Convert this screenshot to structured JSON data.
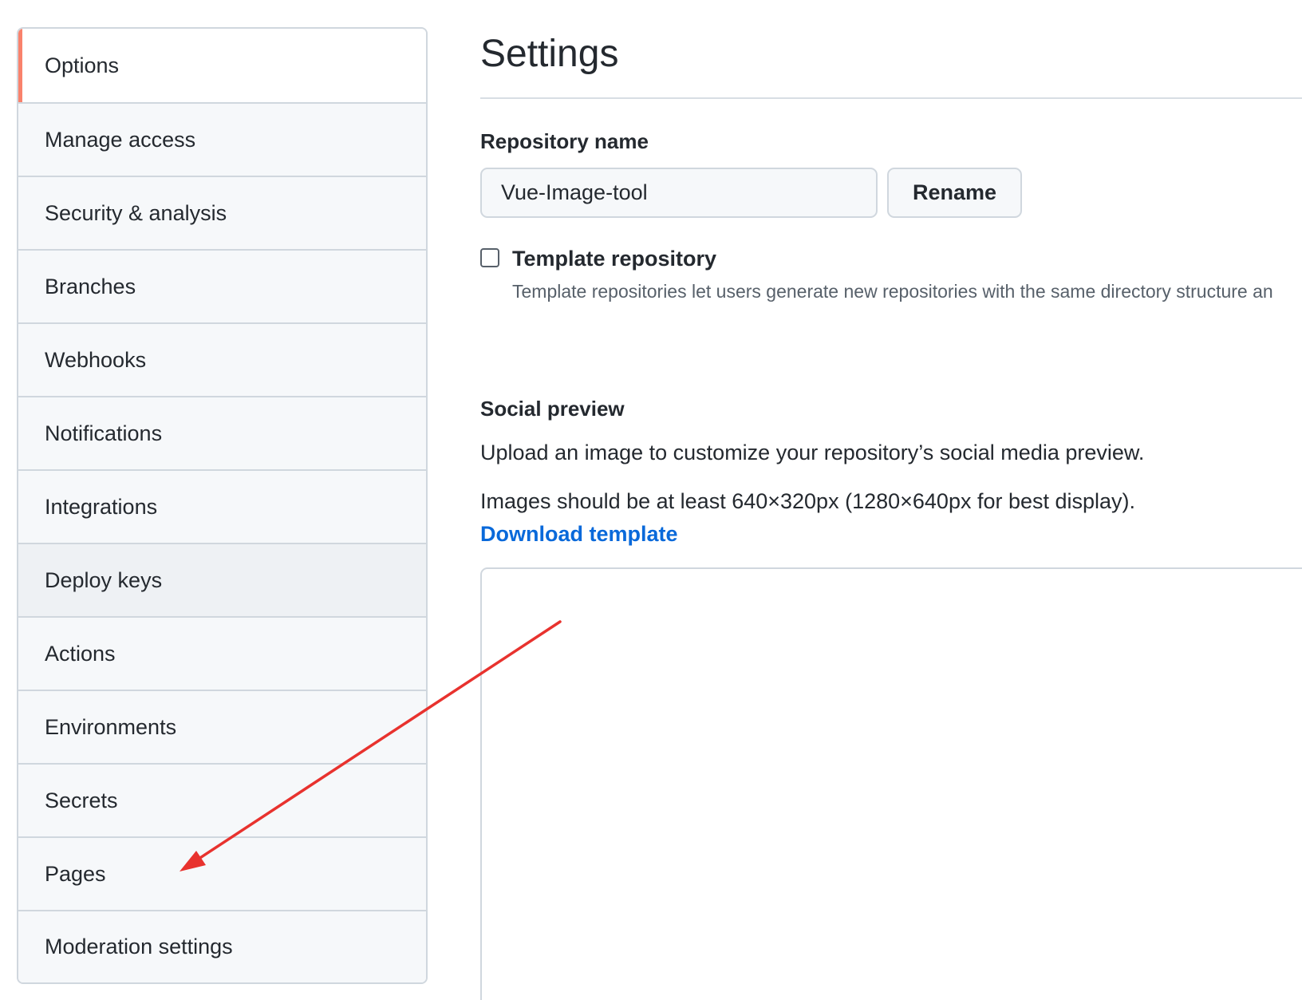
{
  "sidebar": {
    "items": [
      {
        "label": "Options"
      },
      {
        "label": "Manage access"
      },
      {
        "label": "Security & analysis"
      },
      {
        "label": "Branches"
      },
      {
        "label": "Webhooks"
      },
      {
        "label": "Notifications"
      },
      {
        "label": "Integrations"
      },
      {
        "label": "Deploy keys"
      },
      {
        "label": "Actions"
      },
      {
        "label": "Environments"
      },
      {
        "label": "Secrets"
      },
      {
        "label": "Pages"
      },
      {
        "label": "Moderation settings"
      }
    ]
  },
  "main": {
    "title": "Settings",
    "repository_name": {
      "label": "Repository name",
      "value": "Vue-Image-tool",
      "rename_label": "Rename"
    },
    "template_repository": {
      "label": "Template repository",
      "description": "Template repositories let users generate new repositories with the same directory structure an",
      "checked": false
    },
    "social_preview": {
      "label": "Social preview",
      "description": "Upload an image to customize your repository’s social media preview.",
      "size_hint": "Images should be at least 640×320px (1280×640px for best display).",
      "download_link": "Download template"
    }
  },
  "annotation": {
    "type": "red-arrow",
    "color": "#e8322e",
    "points_to": "Pages"
  }
}
